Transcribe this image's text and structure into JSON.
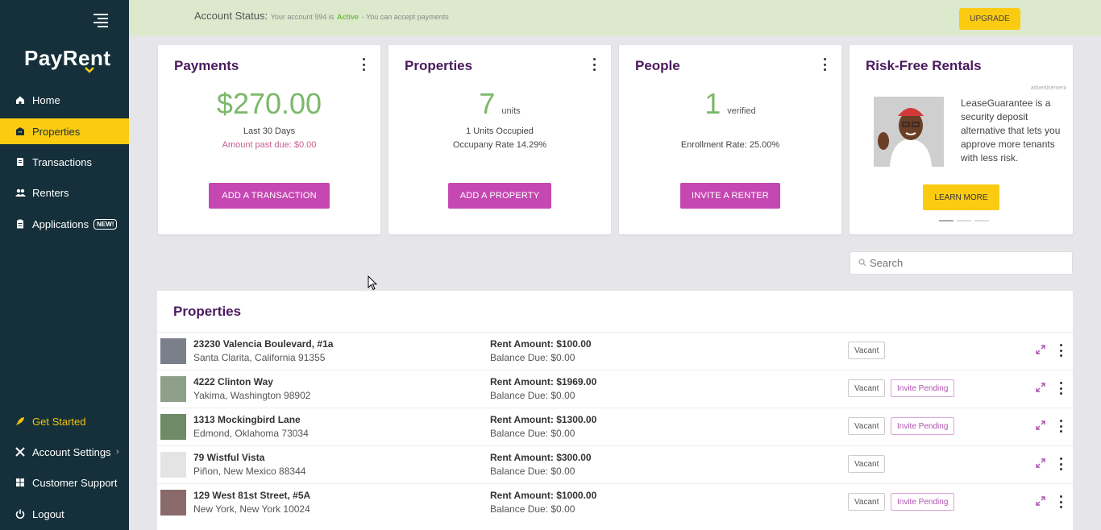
{
  "sidebar": {
    "logo": "PayRent",
    "items": [
      {
        "label": "Home",
        "icon": "home-icon"
      },
      {
        "label": "Properties",
        "icon": "building-icon"
      },
      {
        "label": "Transactions",
        "icon": "receipt-icon"
      },
      {
        "label": "Renters",
        "icon": "users-icon"
      },
      {
        "label": "Applications",
        "icon": "clipboard-icon",
        "badge": "NEW!"
      }
    ],
    "bottom_items": [
      {
        "label": "Get Started",
        "icon": "rocket-icon"
      },
      {
        "label": "Account Settings",
        "icon": "tools-icon"
      },
      {
        "label": "Customer Support",
        "icon": "support-icon"
      },
      {
        "label": "Logout",
        "icon": "power-icon"
      }
    ]
  },
  "banner": {
    "label": "Account Status:",
    "prefix": "Your account 994 is",
    "status": "Active",
    "suffix": "- You can accept payments",
    "upgrade": "UPGRADE"
  },
  "cards": {
    "payments": {
      "title": "Payments",
      "amount": "$270.00",
      "period": "Last 30 Days",
      "past_due": "Amount past due: $0.00",
      "button": "ADD A TRANSACTION"
    },
    "properties": {
      "title": "Properties",
      "count": "7",
      "unit": "units",
      "occupied": "1 Units Occupied",
      "occupancy": "Occupany Rate 14.29%",
      "button": "ADD A PROPERTY"
    },
    "people": {
      "title": "People",
      "count": "1",
      "unit": "verified",
      "enrollment": "Enrollment Rate: 25.00%",
      "button": "INVITE A RENTER"
    },
    "ad": {
      "title": "Risk-Free Rentals",
      "label": "advertisement",
      "text": "LeaseGuarantee is a security deposit alternative that lets you approve more tenants with less risk.",
      "button": "LEARN MORE"
    }
  },
  "search": {
    "placeholder": "Search"
  },
  "properties_table": {
    "title": "Properties",
    "rows": [
      {
        "address": "23230 Valencia Boulevard, #1a",
        "city": "Santa Clarita, California 91355",
        "rent": "Rent Amount: $100.00",
        "balance": "Balance Due: $0.00",
        "status": "Vacant",
        "invite": ""
      },
      {
        "address": "4222 Clinton Way",
        "city": "Yakima, Washington 98902",
        "rent": "Rent Amount: $1969.00",
        "balance": "Balance Due: $0.00",
        "status": "Vacant",
        "invite": "Invite Pending"
      },
      {
        "address": "1313 Mockingbird Lane",
        "city": "Edmond, Oklahoma 73034",
        "rent": "Rent Amount: $1300.00",
        "balance": "Balance Due: $0.00",
        "status": "Vacant",
        "invite": "Invite Pending"
      },
      {
        "address": "79 Wistful Vista",
        "city": "Piñon, New Mexico 88344",
        "rent": "Rent Amount: $300.00",
        "balance": "Balance Due: $0.00",
        "status": "Vacant",
        "invite": ""
      },
      {
        "address": "129 West 81st Street, #5A",
        "city": "New York, New York 10024",
        "rent": "Rent Amount: $1000.00",
        "balance": "Balance Due: $0.00",
        "status": "Vacant",
        "invite": "Invite Pending"
      }
    ]
  },
  "colors": {
    "sidebar": "#15303a",
    "accent": "#fbcb12",
    "purple": "#4a1a5e",
    "button": "#c548b2",
    "green": "#7cb86a"
  }
}
